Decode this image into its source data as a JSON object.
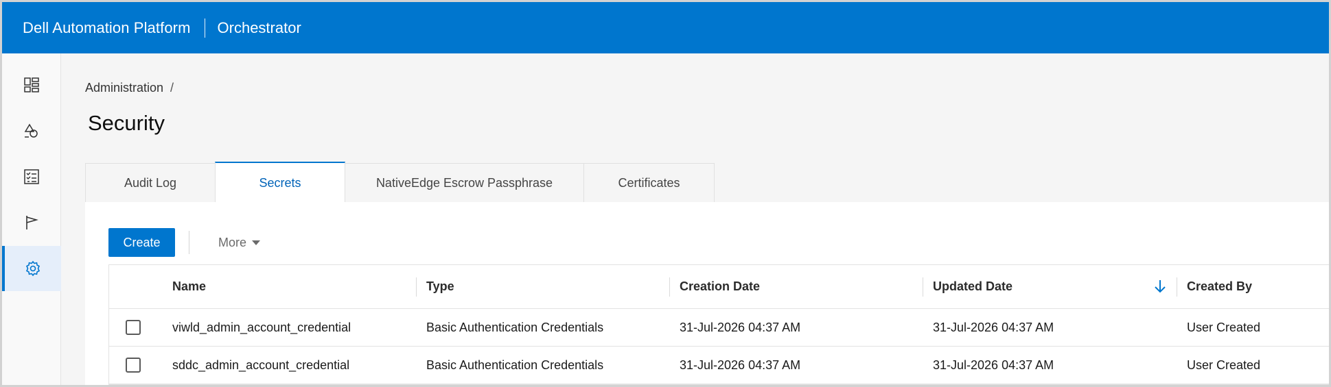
{
  "header": {
    "brand": "Dell Automation Platform",
    "app": "Orchestrator",
    "background_color": "#0076ce"
  },
  "sidebar": {
    "items": [
      {
        "icon": "dashboard-icon",
        "active": false
      },
      {
        "icon": "shapes-icon",
        "active": false
      },
      {
        "icon": "checklist-icon",
        "active": false
      },
      {
        "icon": "flag-icon",
        "active": false
      },
      {
        "icon": "gear-icon",
        "active": true
      }
    ]
  },
  "breadcrumb": {
    "parent": "Administration",
    "separator": "/"
  },
  "page": {
    "title": "Security"
  },
  "tabs": [
    {
      "label": "Audit Log",
      "active": false
    },
    {
      "label": "Secrets",
      "active": true
    },
    {
      "label": "NativeEdge Escrow Passphrase",
      "active": false
    },
    {
      "label": "Certificates",
      "active": false
    }
  ],
  "toolbar": {
    "create_label": "Create",
    "more_label": "More"
  },
  "table": {
    "columns": [
      "Name",
      "Type",
      "Creation Date",
      "Updated Date",
      "Created By"
    ],
    "sort": {
      "column": "Updated Date",
      "direction": "descending"
    },
    "rows": [
      {
        "name": "viwld_admin_account_credential",
        "type": "Basic Authentication Credentials",
        "creation_date": "31-Jul-2026 04:37 AM",
        "updated_date": "31-Jul-2026 04:37 AM",
        "created_by": "User Created"
      },
      {
        "name": "sddc_admin_account_credential",
        "type": "Basic Authentication Credentials",
        "creation_date": "31-Jul-2026 04:37 AM",
        "updated_date": "31-Jul-2026 04:37 AM",
        "created_by": "User Created"
      }
    ]
  }
}
